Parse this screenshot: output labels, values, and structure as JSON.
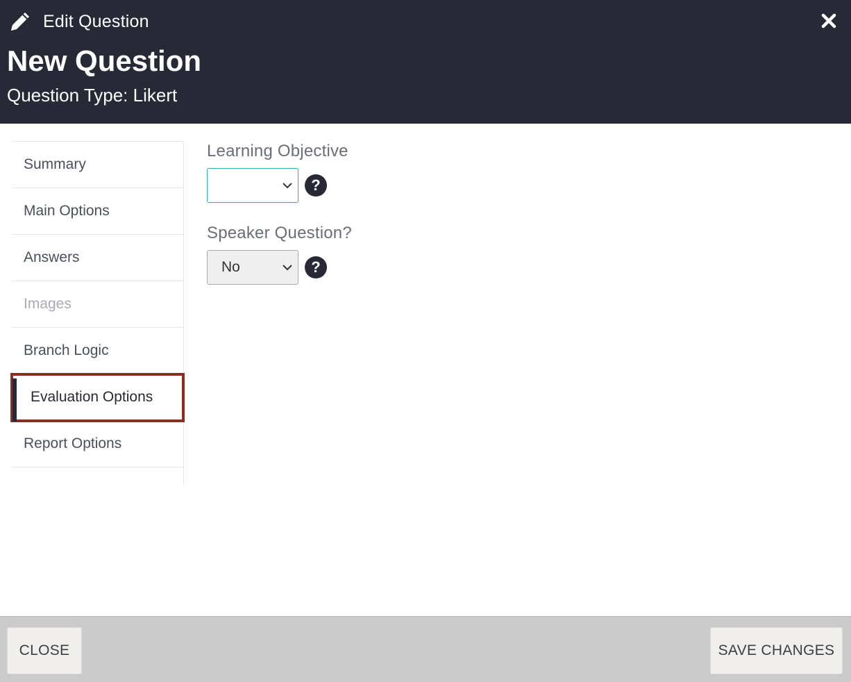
{
  "header": {
    "edit_label": "Edit Question",
    "title": "New Question",
    "subtitle": "Question Type: Likert",
    "icons": {
      "edit": "pencil-icon",
      "close": "close-icon"
    }
  },
  "sidebar": {
    "items": [
      {
        "label": "Summary",
        "state": "normal"
      },
      {
        "label": "Main Options",
        "state": "normal"
      },
      {
        "label": "Answers",
        "state": "normal"
      },
      {
        "label": "Images",
        "state": "disabled"
      },
      {
        "label": "Branch Logic",
        "state": "normal"
      },
      {
        "label": "Evaluation Options",
        "state": "active"
      },
      {
        "label": "Report Options",
        "state": "normal"
      }
    ]
  },
  "form": {
    "learning_objective": {
      "label": "Learning Objective",
      "value": ""
    },
    "speaker_question": {
      "label": "Speaker Question?",
      "value": "No"
    },
    "help_glyph": "?"
  },
  "footer": {
    "close_label": "CLOSE",
    "save_label": "SAVE CHANGES"
  },
  "colors": {
    "header_bg": "#272a36",
    "highlight_border": "#8b2f22",
    "focus_border": "#3aa7b0",
    "footer_bg": "#cbcbcb"
  }
}
